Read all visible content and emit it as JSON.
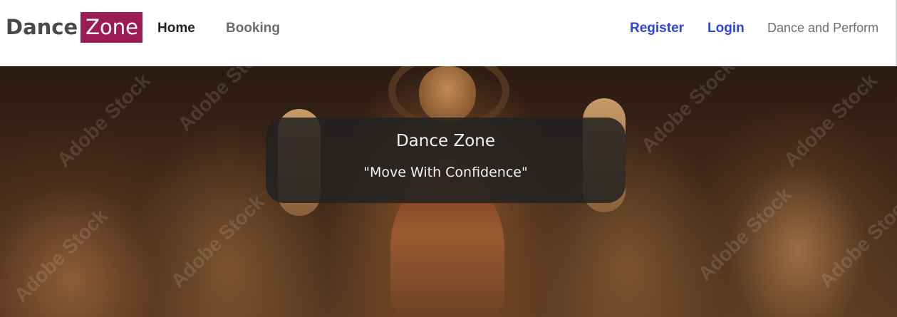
{
  "brand": {
    "part1": "Dance",
    "part2": "Zone",
    "accent_color": "#9b1b55"
  },
  "nav": {
    "links": [
      {
        "label": "Home",
        "active": true
      },
      {
        "label": "Booking",
        "active": false
      }
    ],
    "auth": {
      "register_label": "Register",
      "login_label": "Login",
      "link_color": "#2b44e0"
    },
    "tagline": "Dance and Perform"
  },
  "hero": {
    "title": "Dance Zone",
    "subtitle": "\"Move With Confidence\"",
    "watermark_text": "Adobe Stock"
  }
}
